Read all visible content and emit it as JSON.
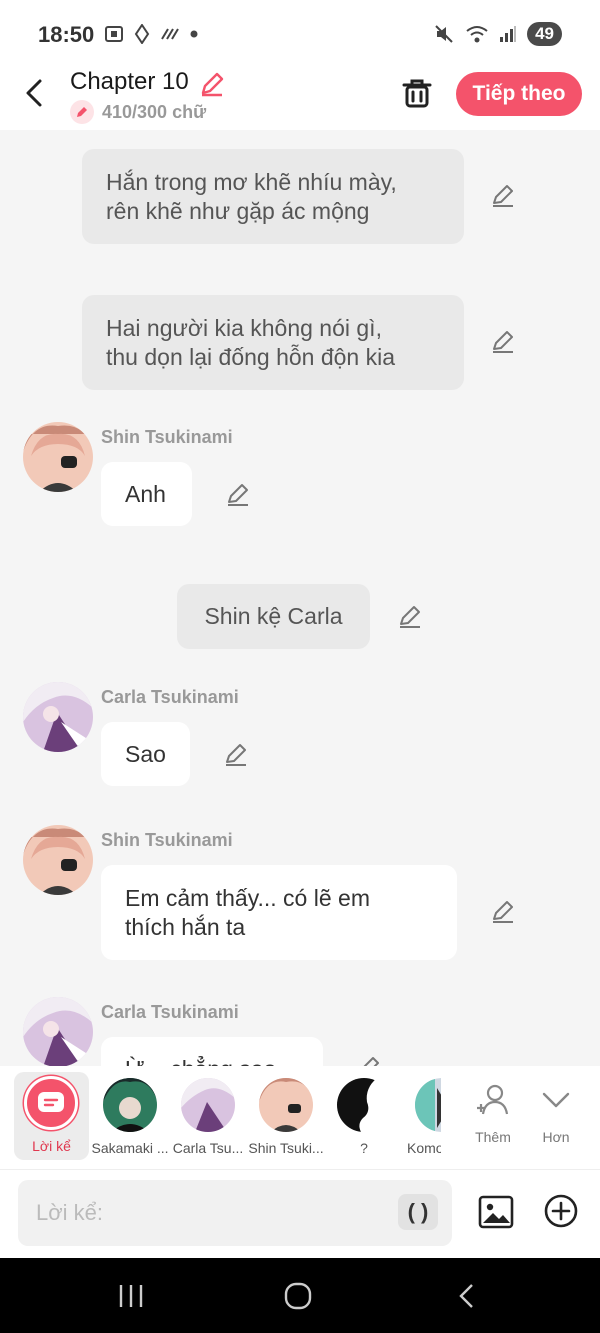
{
  "status": {
    "time": "18:50",
    "battery": "49"
  },
  "header": {
    "title": "Chapter 10",
    "word_count": "410/300 chữ",
    "next_label": "Tiếp theo"
  },
  "messages": [
    {
      "type": "narration",
      "text_line1": "Hắn trong mơ khẽ nhíu mày,",
      "text_line2": "rên khẽ như gặp ác mộng"
    },
    {
      "type": "narration",
      "text_line1": "Hai người kia không nói gì,",
      "text_line2": "thu dọn lại đống hỗn độn kia"
    },
    {
      "type": "character",
      "speaker": "Shin Tsukinami",
      "text": "Anh"
    },
    {
      "type": "narration",
      "text": "Shin kệ Carla"
    },
    {
      "type": "character",
      "speaker": "Carla Tsukinami",
      "text": "Sao"
    },
    {
      "type": "character",
      "speaker": "Shin Tsukinami",
      "text_line1": "Em cảm thấy... có lẽ em",
      "text_line2": "thích hắn ta"
    },
    {
      "type": "character",
      "speaker": "Carla Tsukinami",
      "text": "Ừ... chẳng sao"
    }
  ],
  "characters": [
    {
      "label": "Lời kể",
      "selected": true
    },
    {
      "label": "Sakamaki ..."
    },
    {
      "label": "Carla Tsu..."
    },
    {
      "label": "Shin Tsuki..."
    },
    {
      "label": "?"
    },
    {
      "label": "Komo"
    }
  ],
  "tools": {
    "add_label": "Thêm",
    "more_label": "Hơn"
  },
  "input": {
    "placeholder": "Lời kể:",
    "paren_label": "( )"
  },
  "colors": {
    "accent": "#f4536b",
    "background": "#f5f5f5",
    "narration_bubble": "#e9e9e9"
  }
}
